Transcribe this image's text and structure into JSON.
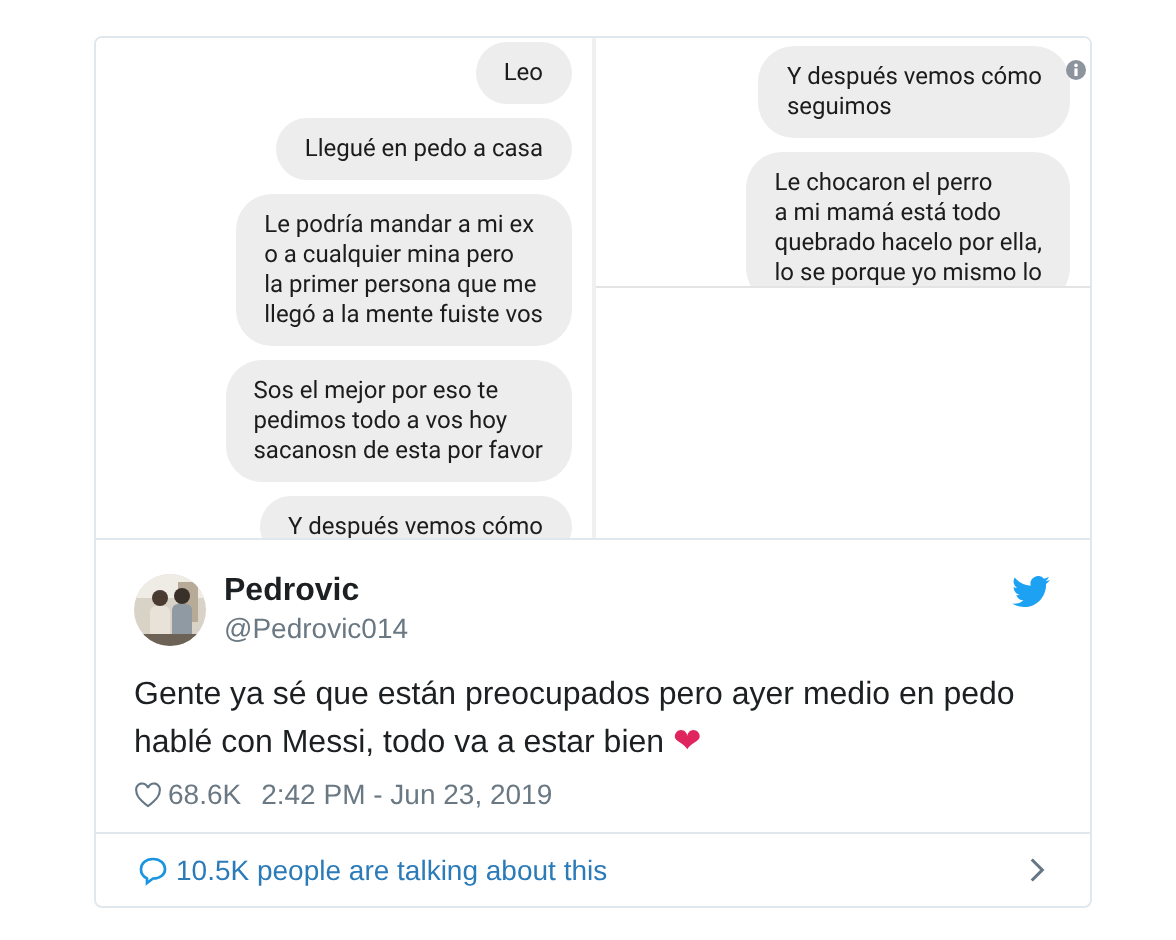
{
  "chat_panels": [
    {
      "messages": [
        {
          "text": "Leo",
          "info": false
        },
        {
          "text": "Llegué en pedo a casa",
          "info": false
        },
        {
          "text": "Le podría mandar a mi ex\no a cualquier mina pero\nla primer persona que me\nllegó a la mente fuiste vos",
          "info": false
        },
        {
          "text": "Sos el mejor por eso te\npedimos todo a vos  hoy\nsacanosn de esta por favor",
          "info": false
        },
        {
          "text": "Y después vemos cómo",
          "info": false
        }
      ]
    },
    {
      "messages": [
        {
          "text": "Y después vemos cómo\nseguimos",
          "info": true
        },
        {
          "text": "Le chocaron el perro\na mi mamá está todo\nquebrado hacelo por ella,\nlo se porque yo mismo lo",
          "info": false
        }
      ]
    }
  ],
  "tweet": {
    "author_name": "Pedrovic",
    "handle": "@Pedrovic014",
    "text": "Gente ya sé que están preocupados pero ayer medio en pedo hablé con Messi, todo va a estar bien",
    "emoji": "❤",
    "likes": "68.6K",
    "timestamp": "2:42 PM - Jun 23, 2019",
    "footer": "10.5K people are talking about this"
  }
}
